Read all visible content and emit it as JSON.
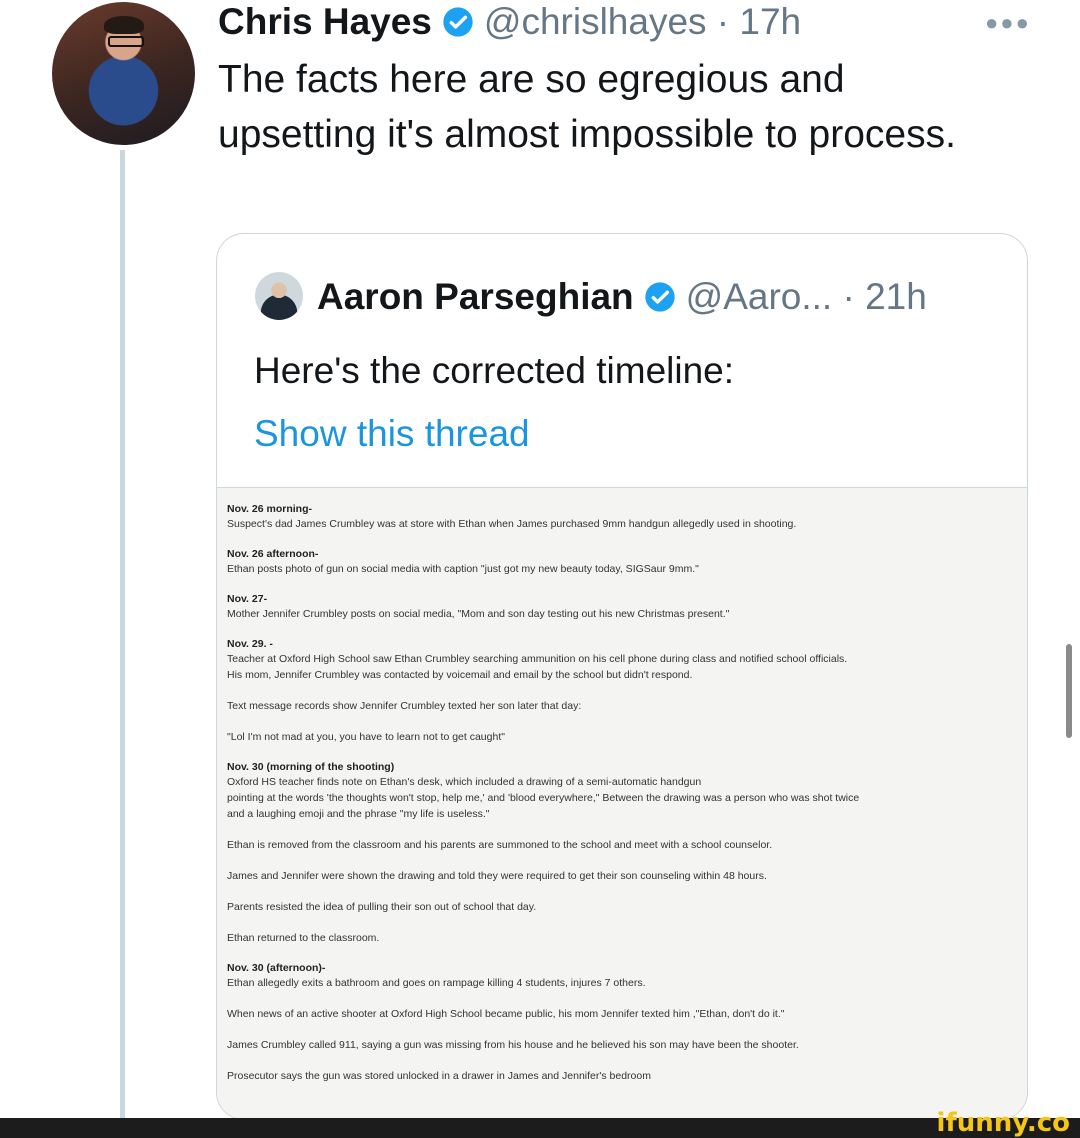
{
  "tweet": {
    "author_name": "Chris Hayes",
    "handle_time": "@chrislhayes · 17h",
    "more_icon": "more-horizontal-icon",
    "text": "The facts here are so egregious and upsetting it's almost impossible to process."
  },
  "quote": {
    "author_name": "Aaron Parseghian",
    "handle_time": "@Aaro... · 21h",
    "text": "Here's the corrected timeline:",
    "link": "Show this thread"
  },
  "timeline": [
    {
      "date": "Nov. 26 morning-",
      "lines": [
        "Suspect's dad James Crumbley was at store with Ethan when James purchased 9mm handgun allegedly used in shooting."
      ]
    },
    {
      "date": "Nov. 26 afternoon-",
      "lines": [
        "Ethan posts photo of gun on social media with caption \"just got my new beauty today, SIGSaur 9mm.\""
      ]
    },
    {
      "date": "Nov. 27-",
      "lines": [
        "Mother Jennifer Crumbley posts on social media, \"Mom and son day testing out his new Christmas present.\""
      ]
    },
    {
      "date": "Nov. 29. -",
      "lines": [
        "Teacher at Oxford High School saw Ethan Crumbley searching ammunition on his cell phone during class and notified school officials.",
        "His mom, Jennifer Crumbley was contacted by voicemail and email by the school but didn't respond."
      ]
    },
    {
      "date": "",
      "lines": [
        "Text message records show Jennifer Crumbley texted her son later that day:"
      ]
    },
    {
      "date": "",
      "lines": [
        "\"Lol I'm not mad at you, you have to learn not to get caught\""
      ]
    },
    {
      "date": "Nov. 30 (morning of the shooting)",
      "lines": [
        "Oxford HS teacher finds note on Ethan's desk, which included a drawing of a semi-automatic handgun",
        "pointing at the words 'the thoughts won't stop, help me,' and 'blood everywhere,\" Between the drawing was a person who was shot twice",
        "and a laughing emoji and the phrase \"my life is useless.\""
      ]
    },
    {
      "date": "",
      "lines": [
        "Ethan is removed from the classroom and his parents are summoned to the school and meet with a school counselor."
      ]
    },
    {
      "date": "",
      "lines": [
        "James and Jennifer were shown the drawing and told they were required to get their son counseling within 48 hours."
      ]
    },
    {
      "date": "",
      "lines": [
        "Parents resisted the idea of pulling their son out of school that day."
      ]
    },
    {
      "date": "",
      "lines": [
        "Ethan returned to the classroom."
      ]
    },
    {
      "date": "Nov. 30 (afternoon)-",
      "lines": [
        "Ethan allegedly exits a bathroom and goes on rampage killing 4 students, injures 7 others."
      ]
    },
    {
      "date": "",
      "lines": [
        "When news of an active shooter at Oxford High School became public, his mom Jennifer texted him ,\"Ethan, don't do it.\""
      ]
    },
    {
      "date": "",
      "lines": [
        "James Crumbley called 911, saying a gun was missing from his house and he believed his son may have been the shooter."
      ]
    },
    {
      "date": "",
      "lines": [
        "Prosecutor says the gun was stored unlocked in a drawer in James and Jennifer's bedroom"
      ]
    }
  ],
  "watermark": "ifunny.co",
  "colors": {
    "verified": "#1da1f2",
    "link": "#1b95e0",
    "muted": "#657786"
  }
}
